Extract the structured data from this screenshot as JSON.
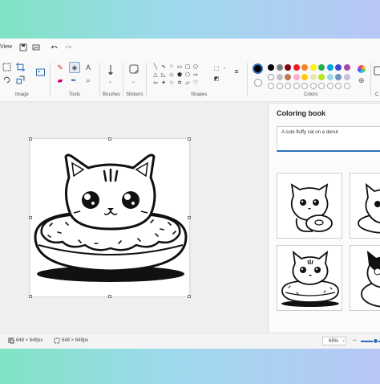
{
  "menu": {
    "view_label": "View"
  },
  "ribbon": {
    "groups": {
      "image": "Image",
      "tools": "Tools",
      "brushes": "Brushes",
      "stickers": "Stickers",
      "shapes": "Shapes",
      "colors": "Colors",
      "creative": "C"
    },
    "text_tool_glyph": "A",
    "palette_row1": [
      "#000000",
      "#7f7f7f",
      "#880015",
      "#ed1c24",
      "#ff7f27",
      "#fff200",
      "#22b14c",
      "#00a2e8",
      "#3f48cc",
      "#a349a4"
    ],
    "palette_row2": [
      "#ffffff",
      "#c3c3c3",
      "#b97a57",
      "#ffaec9",
      "#ffc90e",
      "#efe4b0",
      "#b5e61d",
      "#99d9ea",
      "#7092be",
      "#c8bfe7"
    ],
    "primary_color": "#000000"
  },
  "coloring_book": {
    "title": "Coloring book",
    "prompt": "A cute fluffy cat on a donut"
  },
  "status": {
    "canvas_size_1": "648 × 648px",
    "canvas_size_2": "648 × 648px",
    "zoom": "69%"
  }
}
